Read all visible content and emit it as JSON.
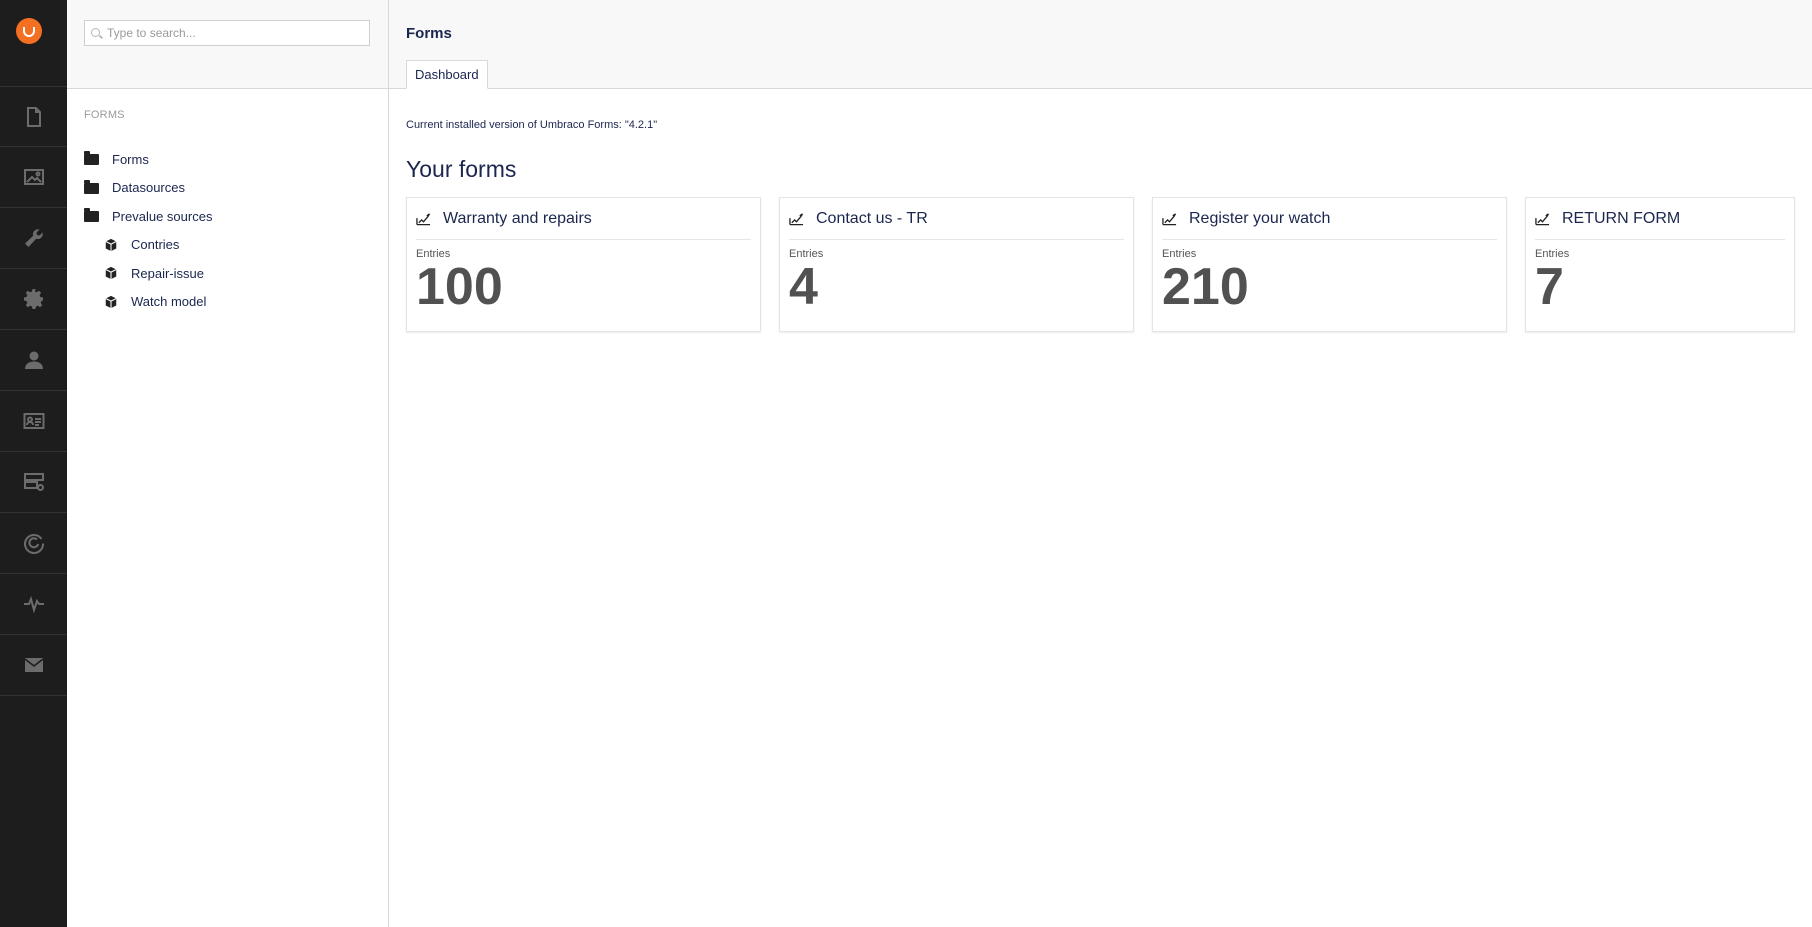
{
  "rail": {
    "items": [
      {
        "name": "content",
        "icon": "document-icon"
      },
      {
        "name": "media",
        "icon": "image-icon"
      },
      {
        "name": "settings",
        "icon": "wrench-icon"
      },
      {
        "name": "developer",
        "icon": "gear-icon"
      },
      {
        "name": "users",
        "icon": "user-icon"
      },
      {
        "name": "members",
        "icon": "id-card-icon"
      },
      {
        "name": "forms",
        "icon": "forms-icon"
      },
      {
        "name": "deploy",
        "icon": "cloud-sync-icon"
      },
      {
        "name": "analytics",
        "icon": "pulse-icon"
      },
      {
        "name": "mail",
        "icon": "envelope-icon"
      }
    ]
  },
  "search": {
    "placeholder": "Type to search..."
  },
  "tree": {
    "title": "FORMS",
    "nodes": [
      {
        "label": "Forms",
        "icon": "folder-icon",
        "level": 0
      },
      {
        "label": "Datasources",
        "icon": "folder-icon",
        "level": 0
      },
      {
        "label": "Prevalue sources",
        "icon": "folder-icon",
        "level": 0
      },
      {
        "label": "Contries",
        "icon": "box-icon",
        "level": 1
      },
      {
        "label": "Repair-issue",
        "icon": "box-icon",
        "level": 1
      },
      {
        "label": "Watch model",
        "icon": "box-icon",
        "level": 1
      }
    ]
  },
  "main": {
    "title": "Forms",
    "tab": "Dashboard",
    "version_text": "Current installed version of Umbraco Forms: \"4.2.1\"",
    "heading": "Your forms",
    "cards": [
      {
        "title": "Warranty and repairs",
        "label": "Entries",
        "value": "100"
      },
      {
        "title": "Contact us - TR",
        "label": "Entries",
        "value": "4"
      },
      {
        "title": "Register your watch",
        "label": "Entries",
        "value": "210"
      },
      {
        "title": "RETURN FORM",
        "label": "Entries",
        "value": "7"
      }
    ]
  },
  "colors": {
    "rail_bg": "#1d1d1d",
    "logo": "#f36f21",
    "text": "#1b264f",
    "value": "#515151"
  }
}
